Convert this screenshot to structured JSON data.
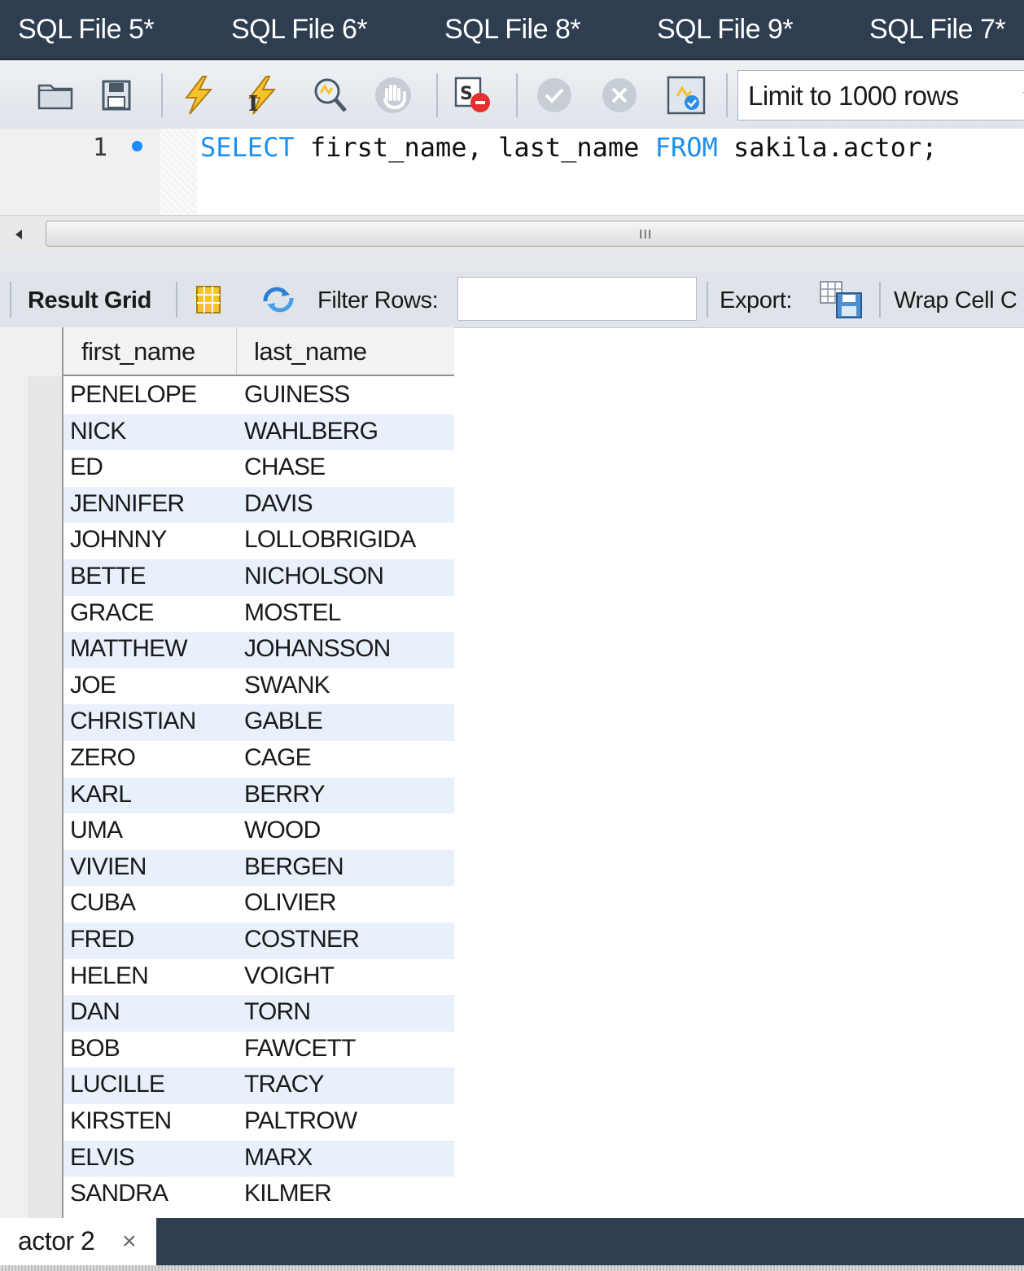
{
  "tabs": [
    {
      "label": "SQL File 5*"
    },
    {
      "label": "SQL File 6*"
    },
    {
      "label": "SQL File 8*"
    },
    {
      "label": "SQL File 9*"
    },
    {
      "label": "SQL File 7*"
    }
  ],
  "toolbar": {
    "icons": [
      "open-folder-icon",
      "save-icon",
      "execute-icon",
      "execute-current-icon",
      "explain-icon",
      "stop-icon",
      "toggle-continue-on-error-icon",
      "commit-icon",
      "rollback-icon",
      "autocommit-icon"
    ],
    "limit_select": "Limit to 1000 rows"
  },
  "editor": {
    "line_number": "1",
    "code": {
      "select_kw": "SELECT",
      "columns": " first_name, last_name ",
      "from_kw": "FROM",
      "table": " sakila.actor;"
    },
    "keyword_color": "#1c8ff0"
  },
  "scrollbar": {
    "grip": "III"
  },
  "result_toolbar": {
    "result_grid": "Result Grid",
    "filter_rows": "Filter Rows:",
    "filter_value": "",
    "export": "Export:",
    "wrap": "Wrap Cell C"
  },
  "grid": {
    "headers": [
      "first_name",
      "last_name"
    ],
    "rows": [
      [
        "PENELOPE",
        "GUINESS"
      ],
      [
        "NICK",
        "WAHLBERG"
      ],
      [
        "ED",
        "CHASE"
      ],
      [
        "JENNIFER",
        "DAVIS"
      ],
      [
        "JOHNNY",
        "LOLLOBRIGIDA"
      ],
      [
        "BETTE",
        "NICHOLSON"
      ],
      [
        "GRACE",
        "MOSTEL"
      ],
      [
        "MATTHEW",
        "JOHANSSON"
      ],
      [
        "JOE",
        "SWANK"
      ],
      [
        "CHRISTIAN",
        "GABLE"
      ],
      [
        "ZERO",
        "CAGE"
      ],
      [
        "KARL",
        "BERRY"
      ],
      [
        "UMA",
        "WOOD"
      ],
      [
        "VIVIEN",
        "BERGEN"
      ],
      [
        "CUBA",
        "OLIVIER"
      ],
      [
        "FRED",
        "COSTNER"
      ],
      [
        "HELEN",
        "VOIGHT"
      ],
      [
        "DAN",
        "TORN"
      ],
      [
        "BOB",
        "FAWCETT"
      ],
      [
        "LUCILLE",
        "TRACY"
      ],
      [
        "KIRSTEN",
        "PALTROW"
      ],
      [
        "ELVIS",
        "MARX"
      ],
      [
        "SANDRA",
        "KILMER"
      ]
    ]
  },
  "result_tab": {
    "label": "actor 2",
    "close": "×"
  },
  "colors": {
    "tabbar": "#2e3d50",
    "alt_row": "#e8f0fb",
    "accent": "#1a8cff"
  }
}
